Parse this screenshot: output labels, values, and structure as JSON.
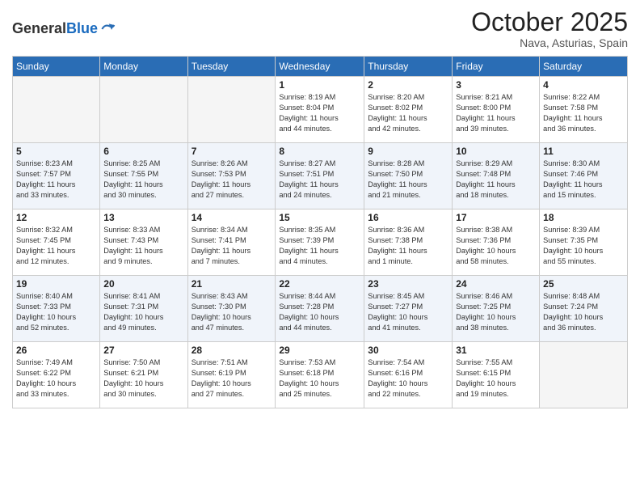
{
  "logo": {
    "general": "General",
    "blue": "Blue"
  },
  "header": {
    "month": "October 2025",
    "location": "Nava, Asturias, Spain"
  },
  "weekdays": [
    "Sunday",
    "Monday",
    "Tuesday",
    "Wednesday",
    "Thursday",
    "Friday",
    "Saturday"
  ],
  "weeks": [
    [
      {
        "day": "",
        "info": ""
      },
      {
        "day": "",
        "info": ""
      },
      {
        "day": "",
        "info": ""
      },
      {
        "day": "1",
        "info": "Sunrise: 8:19 AM\nSunset: 8:04 PM\nDaylight: 11 hours\nand 44 minutes."
      },
      {
        "day": "2",
        "info": "Sunrise: 8:20 AM\nSunset: 8:02 PM\nDaylight: 11 hours\nand 42 minutes."
      },
      {
        "day": "3",
        "info": "Sunrise: 8:21 AM\nSunset: 8:00 PM\nDaylight: 11 hours\nand 39 minutes."
      },
      {
        "day": "4",
        "info": "Sunrise: 8:22 AM\nSunset: 7:58 PM\nDaylight: 11 hours\nand 36 minutes."
      }
    ],
    [
      {
        "day": "5",
        "info": "Sunrise: 8:23 AM\nSunset: 7:57 PM\nDaylight: 11 hours\nand 33 minutes."
      },
      {
        "day": "6",
        "info": "Sunrise: 8:25 AM\nSunset: 7:55 PM\nDaylight: 11 hours\nand 30 minutes."
      },
      {
        "day": "7",
        "info": "Sunrise: 8:26 AM\nSunset: 7:53 PM\nDaylight: 11 hours\nand 27 minutes."
      },
      {
        "day": "8",
        "info": "Sunrise: 8:27 AM\nSunset: 7:51 PM\nDaylight: 11 hours\nand 24 minutes."
      },
      {
        "day": "9",
        "info": "Sunrise: 8:28 AM\nSunset: 7:50 PM\nDaylight: 11 hours\nand 21 minutes."
      },
      {
        "day": "10",
        "info": "Sunrise: 8:29 AM\nSunset: 7:48 PM\nDaylight: 11 hours\nand 18 minutes."
      },
      {
        "day": "11",
        "info": "Sunrise: 8:30 AM\nSunset: 7:46 PM\nDaylight: 11 hours\nand 15 minutes."
      }
    ],
    [
      {
        "day": "12",
        "info": "Sunrise: 8:32 AM\nSunset: 7:45 PM\nDaylight: 11 hours\nand 12 minutes."
      },
      {
        "day": "13",
        "info": "Sunrise: 8:33 AM\nSunset: 7:43 PM\nDaylight: 11 hours\nand 9 minutes."
      },
      {
        "day": "14",
        "info": "Sunrise: 8:34 AM\nSunset: 7:41 PM\nDaylight: 11 hours\nand 7 minutes."
      },
      {
        "day": "15",
        "info": "Sunrise: 8:35 AM\nSunset: 7:39 PM\nDaylight: 11 hours\nand 4 minutes."
      },
      {
        "day": "16",
        "info": "Sunrise: 8:36 AM\nSunset: 7:38 PM\nDaylight: 11 hours\nand 1 minute."
      },
      {
        "day": "17",
        "info": "Sunrise: 8:38 AM\nSunset: 7:36 PM\nDaylight: 10 hours\nand 58 minutes."
      },
      {
        "day": "18",
        "info": "Sunrise: 8:39 AM\nSunset: 7:35 PM\nDaylight: 10 hours\nand 55 minutes."
      }
    ],
    [
      {
        "day": "19",
        "info": "Sunrise: 8:40 AM\nSunset: 7:33 PM\nDaylight: 10 hours\nand 52 minutes."
      },
      {
        "day": "20",
        "info": "Sunrise: 8:41 AM\nSunset: 7:31 PM\nDaylight: 10 hours\nand 49 minutes."
      },
      {
        "day": "21",
        "info": "Sunrise: 8:43 AM\nSunset: 7:30 PM\nDaylight: 10 hours\nand 47 minutes."
      },
      {
        "day": "22",
        "info": "Sunrise: 8:44 AM\nSunset: 7:28 PM\nDaylight: 10 hours\nand 44 minutes."
      },
      {
        "day": "23",
        "info": "Sunrise: 8:45 AM\nSunset: 7:27 PM\nDaylight: 10 hours\nand 41 minutes."
      },
      {
        "day": "24",
        "info": "Sunrise: 8:46 AM\nSunset: 7:25 PM\nDaylight: 10 hours\nand 38 minutes."
      },
      {
        "day": "25",
        "info": "Sunrise: 8:48 AM\nSunset: 7:24 PM\nDaylight: 10 hours\nand 36 minutes."
      }
    ],
    [
      {
        "day": "26",
        "info": "Sunrise: 7:49 AM\nSunset: 6:22 PM\nDaylight: 10 hours\nand 33 minutes."
      },
      {
        "day": "27",
        "info": "Sunrise: 7:50 AM\nSunset: 6:21 PM\nDaylight: 10 hours\nand 30 minutes."
      },
      {
        "day": "28",
        "info": "Sunrise: 7:51 AM\nSunset: 6:19 PM\nDaylight: 10 hours\nand 27 minutes."
      },
      {
        "day": "29",
        "info": "Sunrise: 7:53 AM\nSunset: 6:18 PM\nDaylight: 10 hours\nand 25 minutes."
      },
      {
        "day": "30",
        "info": "Sunrise: 7:54 AM\nSunset: 6:16 PM\nDaylight: 10 hours\nand 22 minutes."
      },
      {
        "day": "31",
        "info": "Sunrise: 7:55 AM\nSunset: 6:15 PM\nDaylight: 10 hours\nand 19 minutes."
      },
      {
        "day": "",
        "info": ""
      }
    ]
  ]
}
